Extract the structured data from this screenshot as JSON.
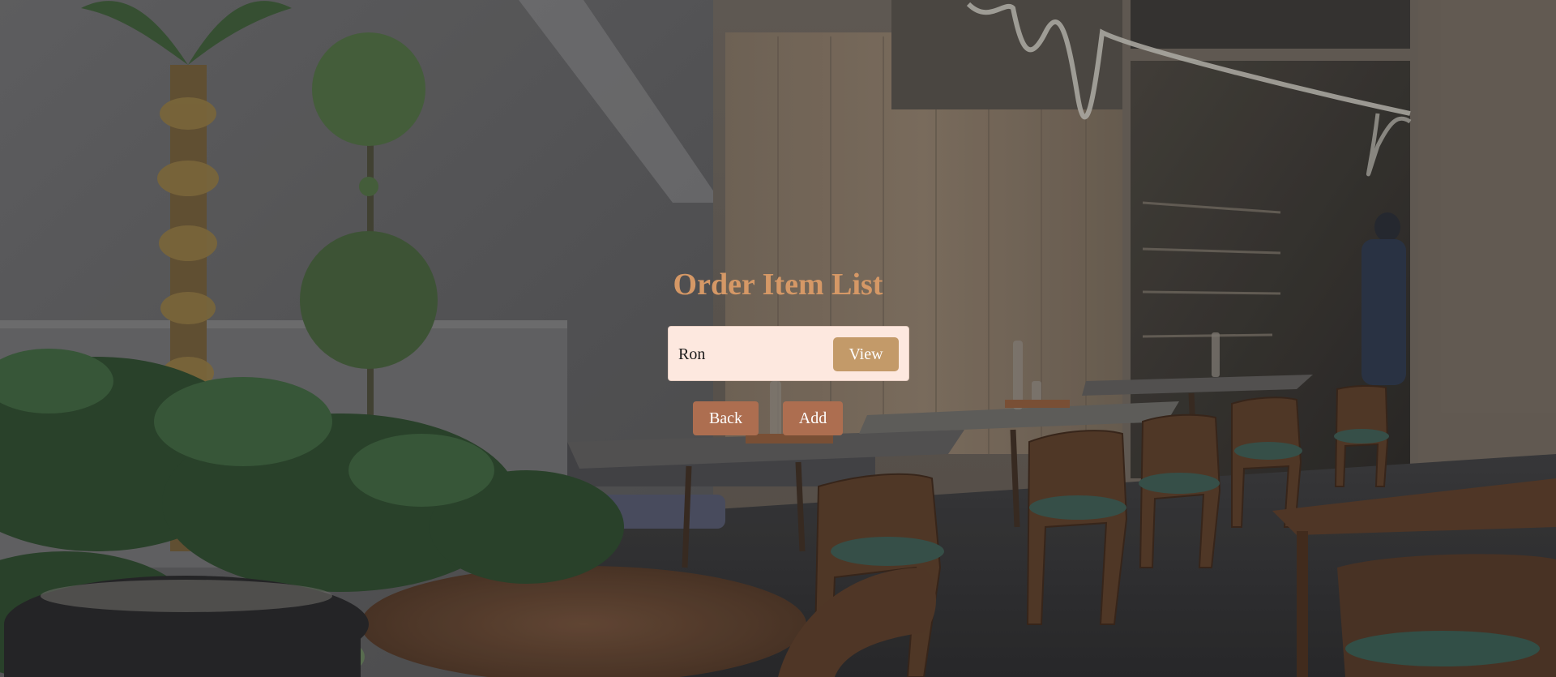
{
  "page": {
    "title": "Order Item List"
  },
  "search": {
    "value": "Ron"
  },
  "buttons": {
    "view_label": "View",
    "back_label": "Back",
    "add_label": "Add"
  },
  "colors": {
    "title": "#d59866",
    "search_box_bg": "#fde8df",
    "view_button": "#c39a69",
    "action_buttons": "#ad6e50"
  }
}
